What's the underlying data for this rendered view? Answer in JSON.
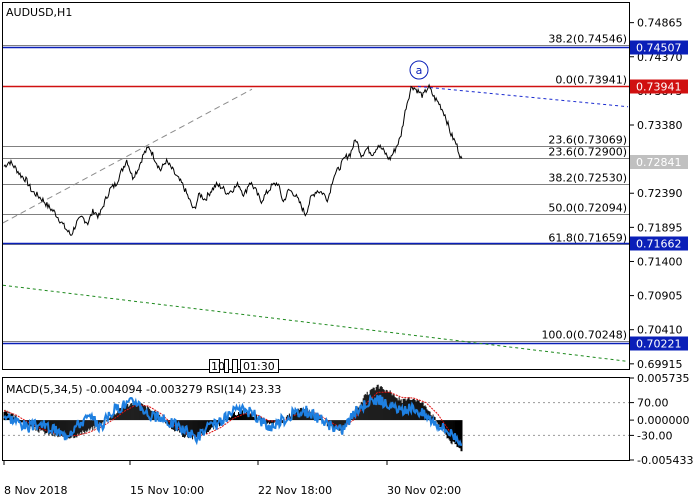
{
  "colors": {
    "price_line": "#000000",
    "blue_level": "#0a1fb8",
    "red_level": "#d01010",
    "fib_line": "#808080",
    "channel_dash": "#8c8c8c",
    "resistance_dash": "#1a2bd0",
    "support_dash": "#1e8a1e",
    "macd_hist": "#000000",
    "macd_signal": "#e01010",
    "rsi_line": "#1e7fe0",
    "price_tag_bg": "#c0c0c0",
    "red_tag_bg": "#d01010",
    "blue_tag_bg": "#0a1fb8"
  },
  "chart_data": [
    {
      "type": "line",
      "title": "AUDUSD,H1",
      "y_range": [
        0.6984,
        0.7515
      ],
      "y_ticks": [
        "0.74865",
        "0.74370",
        "0.73875",
        "0.73380",
        "0.72885",
        "0.72390",
        "0.71895",
        "0.71400",
        "0.70905",
        "0.70410",
        "0.69915"
      ],
      "x_ticks": [
        "8 Nov 2018",
        "15 Nov 10:00",
        "22 Nov 18:00",
        "30 Nov 02:00"
      ],
      "current_price": "0.72841",
      "horizontal_levels": [
        {
          "value": 0.74507,
          "tag": "0.74507",
          "kind": "blue"
        },
        {
          "value": 0.73941,
          "tag": "0.73941",
          "kind": "red"
        },
        {
          "value": 0.71662,
          "tag": "0.71662",
          "kind": "blue"
        },
        {
          "value": 0.70221,
          "tag": "0.70221",
          "kind": "blue"
        }
      ],
      "fibonacci_levels": [
        {
          "label": "38.2(0.74546)",
          "value": 0.74546
        },
        {
          "label": "0.0(0.73941)",
          "value": 0.73941
        },
        {
          "label": "23.6(0.73069)",
          "value": 0.73069
        },
        {
          "label": "23.6(0.72900)",
          "value": 0.729
        },
        {
          "label": "38.2(0.72530)",
          "value": 0.7253
        },
        {
          "label": "50.0(0.72094)",
          "value": 0.72094
        },
        {
          "label": "61.8(0.71659)",
          "value": 0.71659
        },
        {
          "label": "100.0(0.70248)",
          "value": 0.70248
        }
      ],
      "wave_label": "a",
      "scroll_tags": [
        "10",
        "01:30"
      ],
      "series": [
        {
          "values": [
            0.7278,
            0.7285,
            0.7276,
            0.7265,
            0.7258,
            0.7242,
            0.7236,
            0.7229,
            0.7219,
            0.7212,
            0.72,
            0.7188,
            0.7178,
            0.7196,
            0.7204,
            0.7196,
            0.7214,
            0.7205,
            0.7226,
            0.7245,
            0.7252,
            0.727,
            0.7288,
            0.7262,
            0.7274,
            0.7296,
            0.7306,
            0.7289,
            0.7272,
            0.7286,
            0.7275,
            0.7262,
            0.7251,
            0.7233,
            0.7214,
            0.7238,
            0.723,
            0.7242,
            0.7251,
            0.7248,
            0.7239,
            0.7245,
            0.7252,
            0.7236,
            0.7256,
            0.7244,
            0.7227,
            0.7239,
            0.725,
            0.7254,
            0.7226,
            0.7244,
            0.7238,
            0.7224,
            0.7208,
            0.7233,
            0.7243,
            0.724,
            0.723,
            0.7264,
            0.7275,
            0.729,
            0.7296,
            0.7318,
            0.7294,
            0.7304,
            0.7296,
            0.7309,
            0.73,
            0.7288,
            0.7302,
            0.732,
            0.7365,
            0.7395,
            0.7388,
            0.738,
            0.7394,
            0.7378,
            0.7368,
            0.7352,
            0.7325,
            0.731,
            0.7286
          ]
        }
      ]
    },
    {
      "type": "line",
      "title": "MACD(5,34,5) -0.004094 -0.003279 RSI(14) 23.33",
      "y_ticks": [
        "0.005735",
        "70.00",
        "0.000000",
        "-30.00",
        "-0.005433"
      ],
      "series": [
        {
          "name": "MACD(5,34,5)",
          "values": [
            0.0012,
            0.0004,
            -0.0008,
            -0.0015,
            -0.002,
            -0.0024,
            -0.0021,
            -0.0014,
            -0.0006,
            0.0006,
            0.0019,
            0.0025,
            0.0016,
            0.0004,
            -0.0012,
            -0.0022,
            -0.0024,
            -0.0014,
            -0.0005,
            0.0008,
            0.0012,
            0.0005,
            -0.0006,
            -0.0003,
            0.0011,
            0.0016,
            0.0006,
            -0.0008,
            -0.0016,
            0.0008,
            0.0034,
            0.0046,
            0.0038,
            0.0026,
            0.003,
            0.002,
            -0.0004,
            -0.0028,
            -0.0041
          ]
        },
        {
          "name": "signal",
          "values": [
            0.0013,
            0.0007,
            -0.0003,
            -0.0011,
            -0.0017,
            -0.0021,
            -0.0021,
            -0.0017,
            -0.001,
            0.0,
            0.0012,
            0.0021,
            0.0019,
            0.0009,
            -0.0006,
            -0.0017,
            -0.0022,
            -0.0018,
            -0.001,
            0.0002,
            0.0009,
            0.0007,
            -0.0001,
            -0.0002,
            0.0006,
            0.0012,
            0.0009,
            -0.0002,
            -0.0011,
            0.0,
            0.0022,
            0.0038,
            0.0038,
            0.0031,
            0.003,
            0.0024,
            0.0008,
            -0.0016,
            -0.0033
          ]
        },
        {
          "name": "RSI(14)",
          "values": [
            55,
            48,
            40,
            44,
            38,
            30,
            42,
            52,
            40,
            60,
            68,
            72,
            55,
            50,
            45,
            36,
            28,
            40,
            46,
            58,
            62,
            52,
            40,
            48,
            56,
            60,
            52,
            42,
            36,
            56,
            70,
            74,
            66,
            58,
            64,
            54,
            44,
            34,
            23.33
          ]
        }
      ]
    }
  ]
}
